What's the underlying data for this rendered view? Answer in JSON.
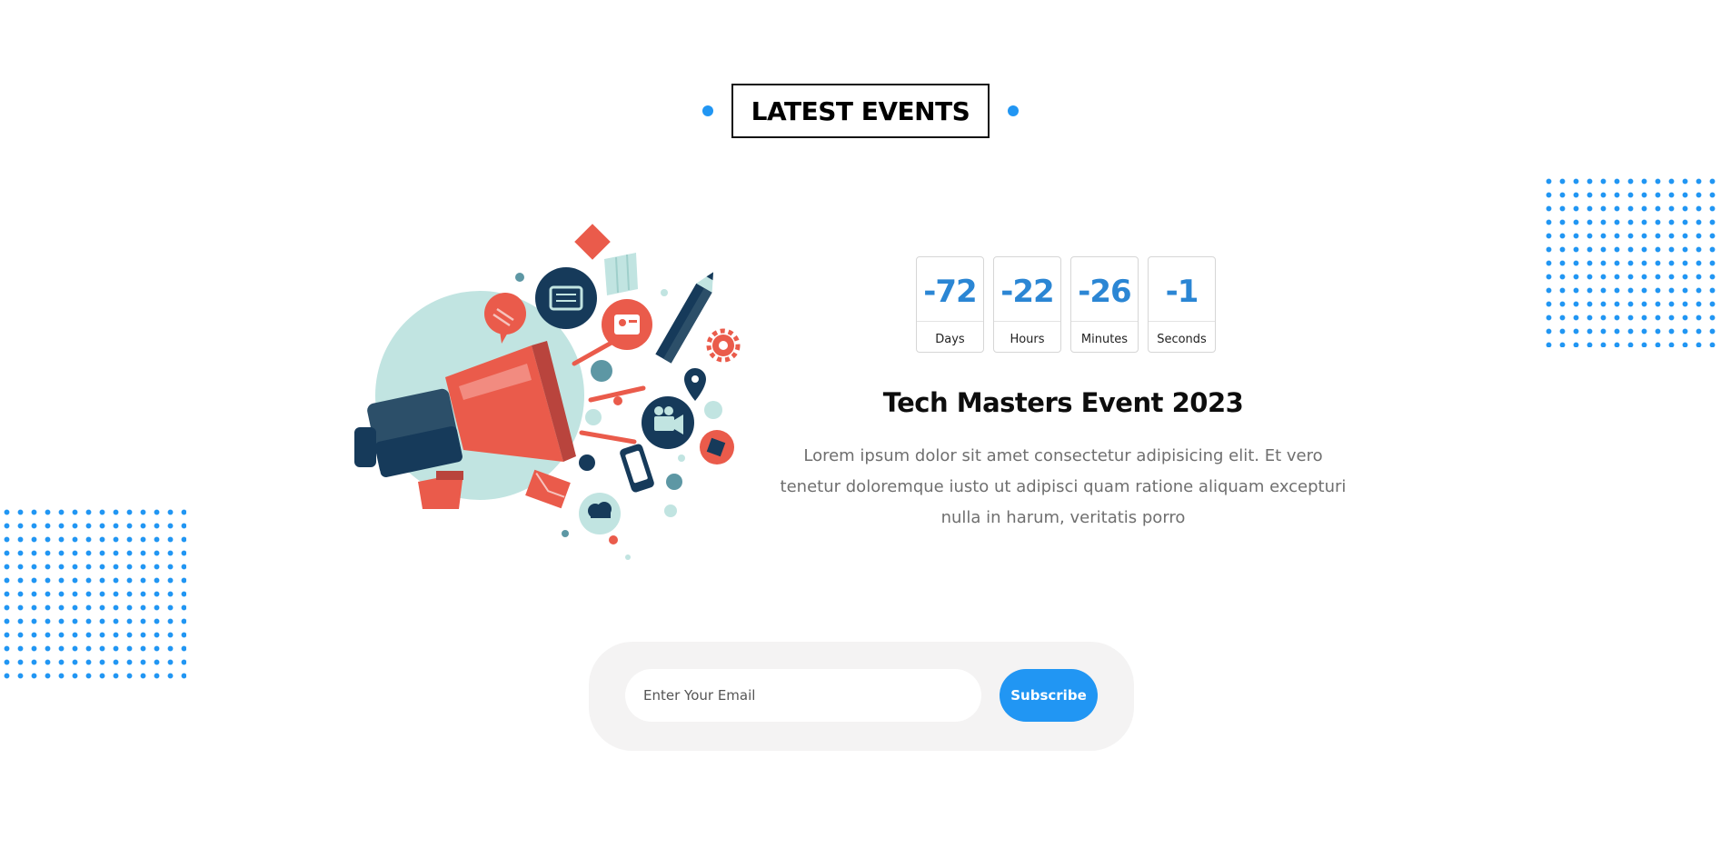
{
  "section": {
    "title": "LATEST EVENTS"
  },
  "countdown": [
    {
      "value": "-72",
      "label": "Days"
    },
    {
      "value": "-22",
      "label": "Hours"
    },
    {
      "value": "-26",
      "label": "Minutes"
    },
    {
      "value": "-1",
      "label": "Seconds"
    }
  ],
  "event": {
    "title": "Tech Masters Event 2023",
    "description": "Lorem ipsum dolor sit amet consectetur adipisicing elit. Et vero tenetur doloremque iusto ut adipisci quam ratione aliquam excepturi nulla in harum, veritatis porro"
  },
  "subscribe": {
    "email_placeholder": "Enter Your Email",
    "button_label": "Subscribe"
  },
  "colors": {
    "accent": "#2196f3",
    "countdown_number": "#2b86d4",
    "megaphone_red": "#ea5b4b",
    "dark_navy": "#163a5a",
    "mint": "#c1e4e1"
  },
  "icons": [
    "megaphone-illustration-icon",
    "newspaper-icon",
    "tv-icon",
    "pencil-icon",
    "gear-icon",
    "map-pin-icon",
    "video-camera-icon",
    "phone-icon",
    "envelope-icon",
    "chat-bubble-icon",
    "cloud-icon",
    "map-icon"
  ]
}
